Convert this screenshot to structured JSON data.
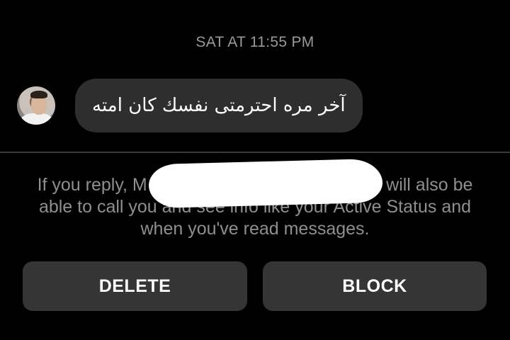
{
  "conversation": {
    "timestamp": "SAT AT 11:55 PM",
    "message": {
      "sender_avatar": "profile-photo",
      "text": "آخر مره احترمتى نفسك كان امته"
    }
  },
  "request_notice": {
    "text_before": "If you reply, M",
    "text_after": "y will also be able to call you and see info like your Active Status and when you've read messages.",
    "redacted": true
  },
  "actions": {
    "delete_label": "DELETE",
    "block_label": "BLOCK"
  },
  "colors": {
    "background": "#000000",
    "bubble": "#2e2e2e",
    "button": "#353535",
    "muted_text": "#8f8f8f"
  }
}
